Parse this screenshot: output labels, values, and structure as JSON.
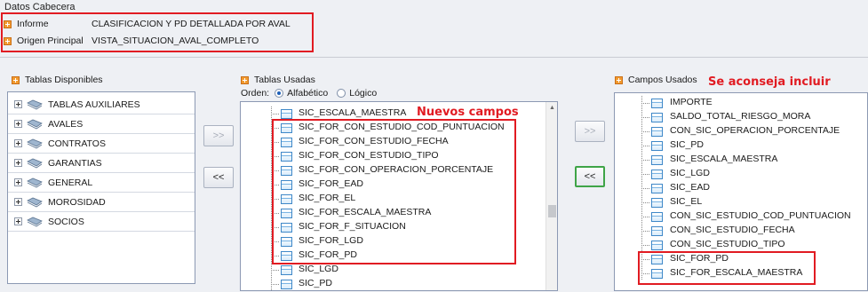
{
  "header": {
    "title": "Datos Cabecera",
    "informe_label": "Informe",
    "informe_value": "CLASIFICACION Y PD DETALLADA POR AVAL",
    "origen_label": "Origen Principal",
    "origen_value": "VISTA_SITUACION_AVAL_COMPLETO"
  },
  "disponibles": {
    "title": "Tablas Disponibles",
    "items": [
      "TABLAS AUXILIARES",
      "AVALES",
      "CONTRATOS",
      "GARANTIAS",
      "GENERAL",
      "MOROSIDAD",
      "SOCIOS"
    ]
  },
  "usadas": {
    "title": "Tablas Usadas",
    "orden_label": "Orden:",
    "opt_alfabetico": "Alfabético",
    "opt_logico": "Lógico",
    "selected_order": "Alfabético",
    "annotation": "Nuevos campos",
    "items": [
      "SIC_ESCALA_MAESTRA",
      "SIC_FOR_CON_ESTUDIO_COD_PUNTUACION",
      "SIC_FOR_CON_ESTUDIO_FECHA",
      "SIC_FOR_CON_ESTUDIO_TIPO",
      "SIC_FOR_CON_OPERACION_PORCENTAJE",
      "SIC_FOR_EAD",
      "SIC_FOR_EL",
      "SIC_FOR_ESCALA_MAESTRA",
      "SIC_FOR_F_SITUACION",
      "SIC_FOR_LGD",
      "SIC_FOR_PD",
      "SIC_LGD",
      "SIC_PD"
    ]
  },
  "campos": {
    "title": "Campos Usados",
    "annotation": "Se aconseja incluir",
    "items": [
      "IMPORTE",
      "SALDO_TOTAL_RIESGO_MORA",
      "CON_SIC_OPERACION_PORCENTAJE",
      "SIC_PD",
      "SIC_ESCALA_MAESTRA",
      "SIC_LGD",
      "SIC_EAD",
      "SIC_EL",
      "CON_SIC_ESTUDIO_COD_PUNTUACION",
      "CON_SIC_ESTUDIO_FECHA",
      "CON_SIC_ESTUDIO_TIPO",
      "SIC_FOR_PD",
      "SIC_FOR_ESCALA_MAESTRA"
    ]
  },
  "buttons": {
    "add_right": ">>",
    "remove_left": "<<",
    "add_right_2": ">>",
    "remove_left_2": "<<"
  },
  "colors": {
    "annotation_red": "#e11b22",
    "accent_orange": "#f29a2e",
    "focus_green": "#3fa447"
  }
}
